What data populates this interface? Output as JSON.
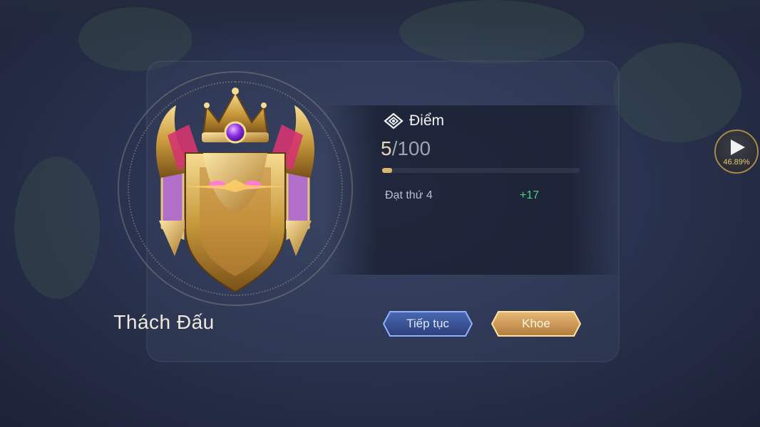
{
  "rank": {
    "name": "Thách Đấu",
    "emblem": "challenger-emblem"
  },
  "score": {
    "title": "Điểm",
    "icon": "diamond-rank-icon",
    "current": "5",
    "separator": "/",
    "max": "100",
    "progress": 0.05
  },
  "result_row": {
    "label": "Đạt thứ 4",
    "value": "+17"
  },
  "buttons": {
    "continue": "Tiếp tục",
    "brag": "Khoe"
  },
  "autoplay": {
    "icon": "play-icon",
    "percent": "46.89%"
  },
  "colors": {
    "gain": "#4fd17e",
    "gold": "#d8b76d",
    "accent_blue": "#6f8fd8"
  }
}
